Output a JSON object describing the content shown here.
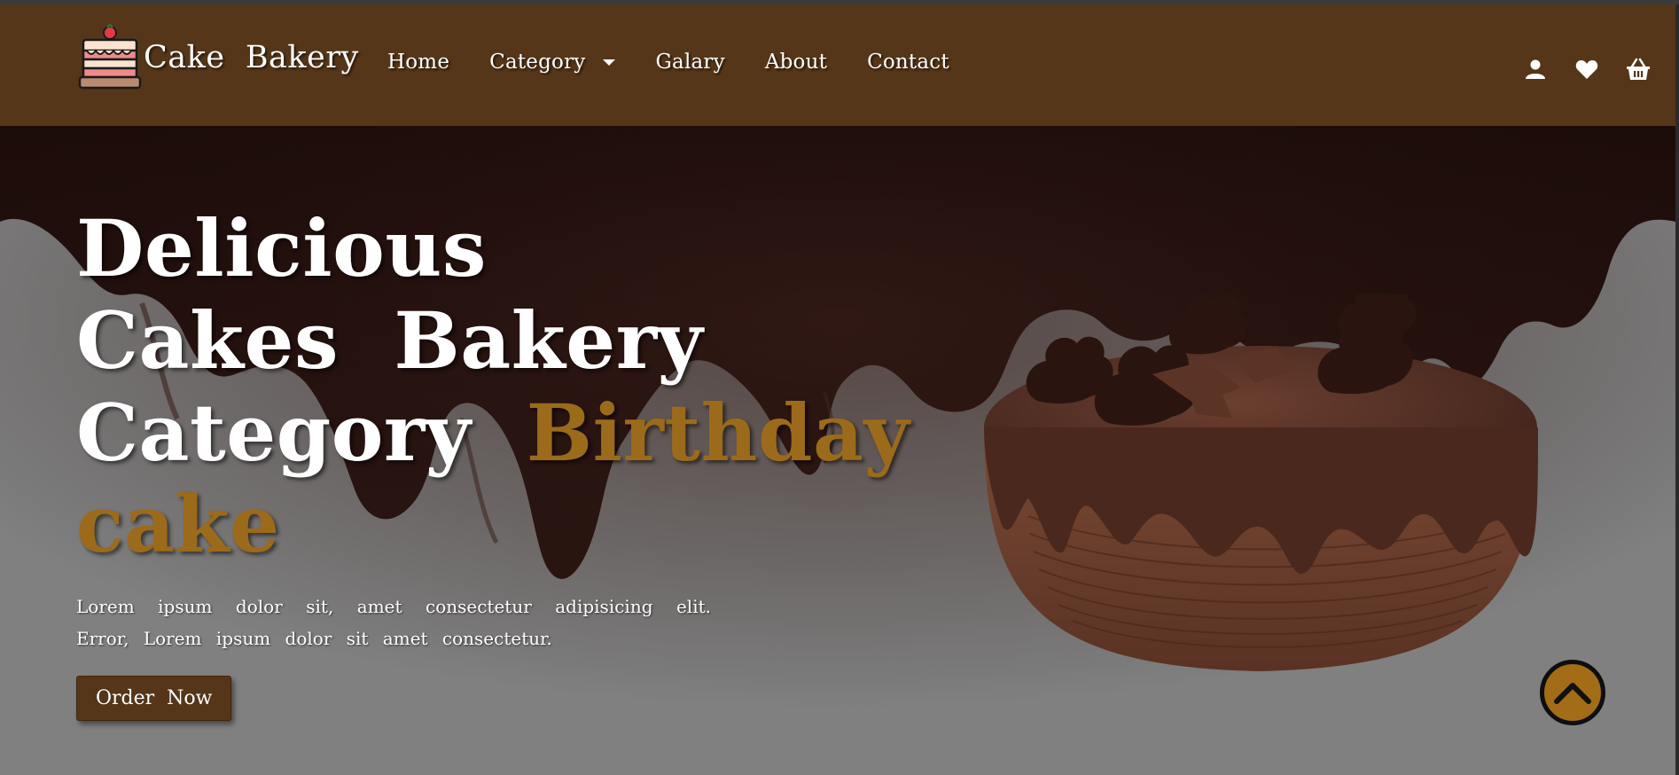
{
  "brand": {
    "name": "Cake  Bakery"
  },
  "nav": {
    "items": [
      {
        "label": "Home"
      },
      {
        "label": "Category"
      },
      {
        "label": "Galary"
      },
      {
        "label": "About"
      },
      {
        "label": "Contact"
      }
    ],
    "icons": [
      "user-icon",
      "heart-icon",
      "basket-icon"
    ]
  },
  "hero": {
    "line1": "Delicious",
    "line2": "Cakes  Bakery",
    "line3_white": "Category  ",
    "line3_accent": "Birthday",
    "line4_accent": "cake",
    "paragraph": "Lorem ipsum dolor sit, amet consectetur adipisicing elit. Error, Lorem ipsum dolor sit amet consectetur.",
    "button_label": "Order  Now"
  },
  "colors": {
    "header_bg": "#553619",
    "accent": "#9c6a1b",
    "chocolate": "#1f0e0b",
    "page_bg": "#808080",
    "back_to_top": "#a36d17"
  },
  "back_to_top": {
    "icon": "chevron-up-icon"
  }
}
